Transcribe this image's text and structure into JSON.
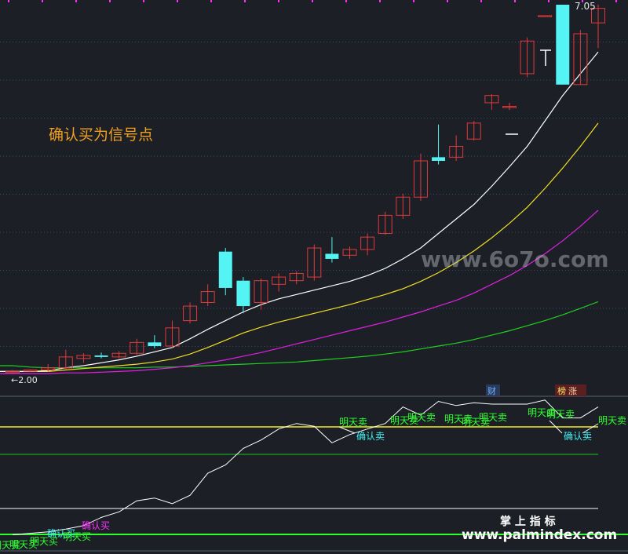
{
  "main_panel": {
    "annotation": "确认买为信号点",
    "high_label": "7.05",
    "low_label": "←2.00",
    "markers": {
      "cai": "财",
      "bang": "榜",
      "bang_rest": "涨"
    }
  },
  "sub_panel": {
    "labels": {
      "mingtian_mai": "明天卖",
      "queren_mai": "确认卖",
      "queren_buy": "确认买",
      "mingtian_buy": "明天买"
    },
    "title": "掌 上 指 标",
    "watermark_bottom": "www.palmindex.com"
  },
  "watermark_main": "www.6o7o.com",
  "colors": {
    "background": "#1c1f26",
    "up": "#e03a3a",
    "down": "#54f4f4",
    "ma5": "#ffffff",
    "ma10": "#f0e020",
    "ma20": "#e020e0",
    "ma60": "#20d020",
    "label_orange": "#f0a020",
    "label_green": "#30ff30",
    "label_cyan": "#40f0f0",
    "label_magenta": "#ff30ff"
  },
  "chart_data": {
    "type": "candlestick",
    "candles": [
      {
        "o": 2.0,
        "h": 2.02,
        "l": 1.98,
        "c": 2.0
      },
      {
        "o": 2.01,
        "h": 2.03,
        "l": 1.99,
        "c": 2.02
      },
      {
        "o": 2.02,
        "h": 2.1,
        "l": 2.0,
        "c": 2.05
      },
      {
        "o": 2.05,
        "h": 2.3,
        "l": 2.03,
        "c": 2.2
      },
      {
        "o": 2.18,
        "h": 2.25,
        "l": 2.12,
        "c": 2.22
      },
      {
        "o": 2.22,
        "h": 2.26,
        "l": 2.18,
        "c": 2.2
      },
      {
        "o": 2.2,
        "h": 2.28,
        "l": 2.18,
        "c": 2.25
      },
      {
        "o": 2.25,
        "h": 2.45,
        "l": 2.23,
        "c": 2.4
      },
      {
        "o": 2.4,
        "h": 2.5,
        "l": 2.32,
        "c": 2.35
      },
      {
        "o": 2.35,
        "h": 2.7,
        "l": 2.33,
        "c": 2.6
      },
      {
        "o": 2.7,
        "h": 2.95,
        "l": 2.66,
        "c": 2.9
      },
      {
        "o": 2.95,
        "h": 3.2,
        "l": 2.9,
        "c": 3.1
      },
      {
        "o": 3.65,
        "h": 3.7,
        "l": 3.05,
        "c": 3.15
      },
      {
        "o": 3.25,
        "h": 3.3,
        "l": 2.8,
        "c": 2.9
      },
      {
        "o": 2.95,
        "h": 3.28,
        "l": 2.85,
        "c": 3.25
      },
      {
        "o": 3.2,
        "h": 3.35,
        "l": 3.1,
        "c": 3.3
      },
      {
        "o": 3.25,
        "h": 3.38,
        "l": 3.2,
        "c": 3.35
      },
      {
        "o": 3.3,
        "h": 3.75,
        "l": 3.25,
        "c": 3.7
      },
      {
        "o": 3.62,
        "h": 3.85,
        "l": 3.5,
        "c": 3.55
      },
      {
        "o": 3.6,
        "h": 3.72,
        "l": 3.55,
        "c": 3.68
      },
      {
        "o": 3.68,
        "h": 3.9,
        "l": 3.6,
        "c": 3.85
      },
      {
        "o": 3.9,
        "h": 4.2,
        "l": 3.88,
        "c": 4.15
      },
      {
        "o": 4.15,
        "h": 4.45,
        "l": 4.1,
        "c": 4.4
      },
      {
        "o": 4.4,
        "h": 5.0,
        "l": 4.35,
        "c": 4.9
      },
      {
        "o": 4.95,
        "h": 5.4,
        "l": 4.85,
        "c": 4.9
      },
      {
        "o": 4.95,
        "h": 5.25,
        "l": 4.9,
        "c": 5.1
      },
      {
        "o": 5.2,
        "h": 5.45,
        "l": 5.18,
        "c": 5.42
      },
      {
        "o": 5.7,
        "h": 5.82,
        "l": 5.6,
        "c": 5.8
      },
      {
        "o": 5.65,
        "h": 5.7,
        "l": 5.6,
        "c": 5.65
      },
      {
        "o": 6.1,
        "h": 6.6,
        "l": 6.05,
        "c": 6.55
      },
      {
        "o": 6.9,
        "h": 6.9,
        "l": 6.9,
        "c": 6.9
      },
      {
        "o": 7.05,
        "h": 7.05,
        "l": 5.95,
        "c": 5.95
      },
      {
        "o": 5.95,
        "h": 6.7,
        "l": 5.95,
        "c": 6.65
      },
      {
        "o": 6.8,
        "h": 7.05,
        "l": 6.45,
        "c": 7.0
      }
    ],
    "ma": {
      "ma5": [
        2.0,
        2.0,
        2.01,
        2.05,
        2.08,
        2.12,
        2.16,
        2.21,
        2.27,
        2.33,
        2.45,
        2.58,
        2.7,
        2.82,
        2.92,
        3.0,
        3.06,
        3.12,
        3.18,
        3.24,
        3.32,
        3.42,
        3.55,
        3.7,
        3.9,
        4.1,
        4.3,
        4.55,
        4.82,
        5.1,
        5.45,
        5.8,
        6.1,
        6.4
      ],
      "ma10": [
        2.0,
        2.0,
        2.0,
        2.02,
        2.04,
        2.06,
        2.08,
        2.1,
        2.13,
        2.17,
        2.24,
        2.33,
        2.43,
        2.53,
        2.61,
        2.68,
        2.74,
        2.8,
        2.86,
        2.92,
        2.99,
        3.06,
        3.14,
        3.24,
        3.36,
        3.5,
        3.66,
        3.84,
        4.04,
        4.26,
        4.52,
        4.8,
        5.1,
        5.42
      ],
      "ma20": [
        1.97,
        1.97,
        1.97,
        1.98,
        1.98,
        1.99,
        2.0,
        2.01,
        2.03,
        2.05,
        2.08,
        2.12,
        2.16,
        2.21,
        2.26,
        2.32,
        2.38,
        2.44,
        2.5,
        2.56,
        2.62,
        2.68,
        2.75,
        2.82,
        2.9,
        2.98,
        3.08,
        3.2,
        3.32,
        3.46,
        3.62,
        3.8,
        4.0,
        4.22
      ],
      "ma60": [
        2.08,
        2.06,
        2.05,
        2.05,
        2.05,
        2.05,
        2.05,
        2.05,
        2.06,
        2.06,
        2.07,
        2.08,
        2.09,
        2.1,
        2.11,
        2.12,
        2.13,
        2.15,
        2.17,
        2.19,
        2.21,
        2.24,
        2.27,
        2.31,
        2.35,
        2.39,
        2.44,
        2.5,
        2.56,
        2.63,
        2.7,
        2.78,
        2.87,
        2.96
      ]
    },
    "oscillator": [
      1.5,
      2.5,
      3.5,
      5.5,
      8,
      14,
      18,
      26,
      28,
      24,
      30,
      46,
      52,
      64,
      70,
      78,
      82,
      80,
      68,
      74,
      78,
      82,
      94,
      88,
      98,
      95,
      97,
      96,
      96,
      96,
      99,
      86,
      86,
      94
    ],
    "ylim": [
      1.95,
      7.05
    ],
    "osc_ylim": [
      0,
      100
    ],
    "osc_levels": [
      90,
      80,
      20,
      0
    ]
  }
}
